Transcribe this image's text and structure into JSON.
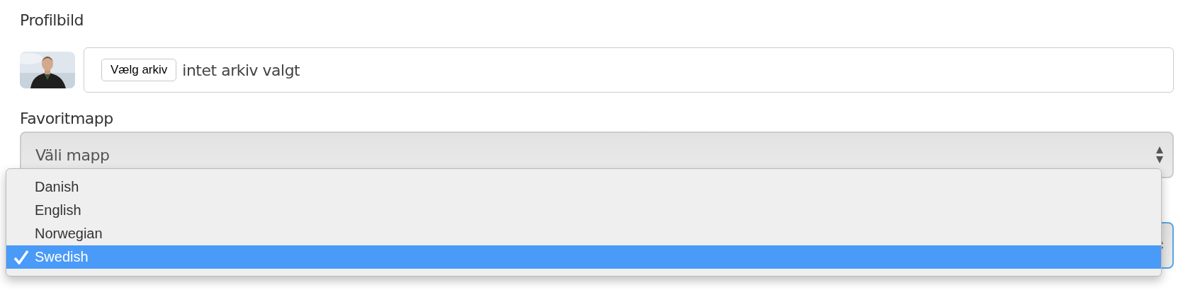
{
  "profile_picture": {
    "label": "Profilbild",
    "file_button": "Vælg arkiv",
    "file_status": "intet arkiv valgt"
  },
  "favorite_folder": {
    "label": "Favoritmapp",
    "value": "Väli mapp"
  },
  "language_select": {
    "focused": true
  },
  "dropdown": {
    "options": [
      {
        "label": "Danish",
        "selected": false
      },
      {
        "label": "English",
        "selected": false
      },
      {
        "label": "Norwegian",
        "selected": false
      },
      {
        "label": "Swedish",
        "selected": true
      }
    ]
  }
}
